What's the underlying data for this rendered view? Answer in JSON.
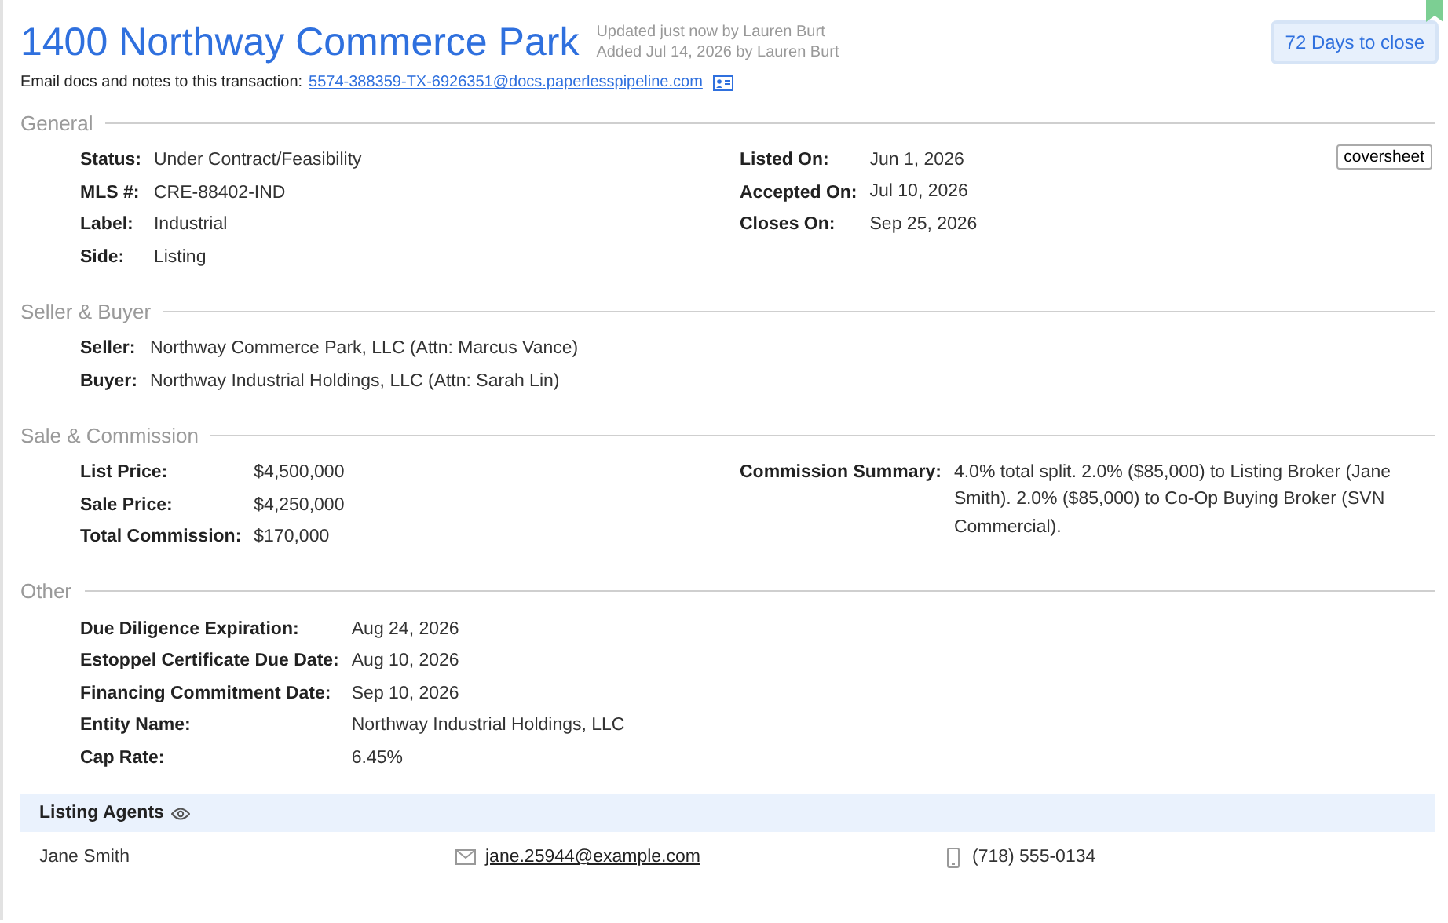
{
  "header": {
    "title": "1400 Northway Commerce Park",
    "updated": "Updated just now by Lauren Burt",
    "added": "Added Jul 14, 2026 by Lauren Burt",
    "days_to_close": "72 Days to close",
    "email_prompt": "Email docs and notes to this transaction:",
    "email_address": "5574-388359-TX-6926351@docs.paperlesspipeline.com"
  },
  "sections": [
    {
      "title": "General",
      "action": "coversheet",
      "columns": [
        [
          {
            "label": "Status:",
            "value": "Under Contract/Feasibility"
          },
          {
            "label": "MLS #:",
            "value": "CRE-88402-IND"
          },
          {
            "label": "Label:",
            "value": "Industrial"
          },
          {
            "label": "Side:",
            "value": "Listing"
          }
        ],
        [
          {
            "label": "Listed On:",
            "value": "Jun 1, 2026"
          },
          {
            "label": "Accepted On:",
            "value": "Jul 10, 2026"
          },
          {
            "label": "Closes On:",
            "value": "Sep 25, 2026"
          }
        ]
      ]
    },
    {
      "title": "Seller & Buyer",
      "columns": [
        [
          {
            "label": "Seller:",
            "value": "Northway Commerce Park, LLC (Attn: Marcus Vance)"
          },
          {
            "label": "Buyer:",
            "value": "Northway Industrial Holdings, LLC (Attn: Sarah Lin)"
          }
        ]
      ]
    },
    {
      "title": "Sale & Commission",
      "columns": [
        [
          {
            "label": "List Price:",
            "value": "$4,500,000"
          },
          {
            "label": "Sale Price:",
            "value": "$4,250,000"
          },
          {
            "label": "Total Commission:",
            "value": "$170,000"
          }
        ],
        [
          {
            "label": "Commission Summary:",
            "value": "4.0% total split. 2.0% ($85,000) to Listing Broker (Jane Smith). 2.0% ($85,000) to Co-Op Buying Broker (SVN Commercial)."
          }
        ]
      ]
    },
    {
      "title": "Other",
      "columns": [
        [
          {
            "label": "Due Diligence Expiration:",
            "value": "Aug 24, 2026"
          },
          {
            "label": "Estoppel Certificate Due Date:",
            "value": "Aug 10, 2026"
          },
          {
            "label": "Financing Commitment Date:",
            "value": "Sep 10, 2026"
          },
          {
            "label": "Entity Name:",
            "value": "Northway Industrial Holdings, LLC"
          },
          {
            "label": "Cap Rate:",
            "value": "6.45%"
          }
        ]
      ]
    }
  ],
  "listing_agents": {
    "title": "Listing Agents",
    "agents": [
      {
        "name": "Jane Smith",
        "email": "jane.25944@example.com",
        "phone": "(718) 555-0134"
      }
    ]
  }
}
